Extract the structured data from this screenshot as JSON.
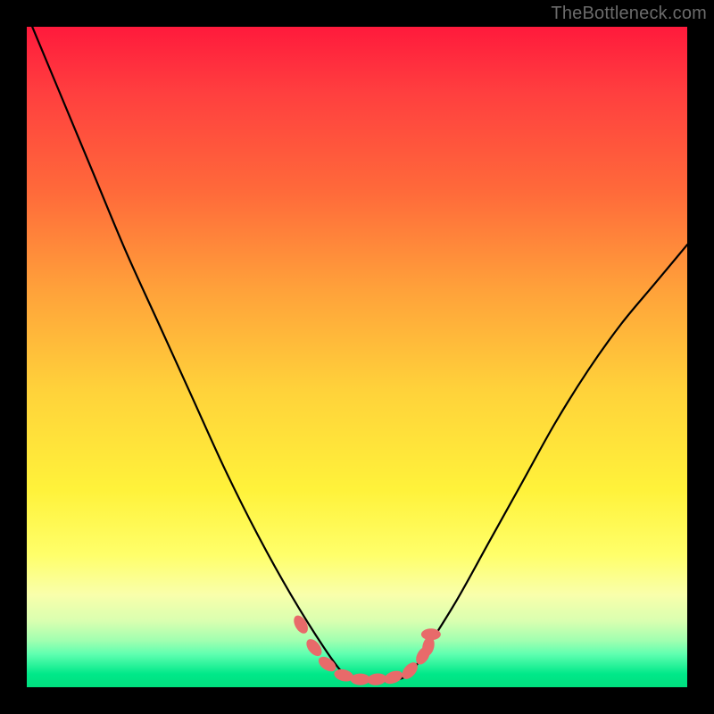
{
  "watermark": "TheBottleneck.com",
  "chart_data": {
    "type": "line",
    "title": "",
    "xlabel": "",
    "ylabel": "",
    "xlim": [
      0,
      1
    ],
    "ylim": [
      0,
      1
    ],
    "series": [
      {
        "name": "curve",
        "x": [
          0.0,
          0.05,
          0.1,
          0.15,
          0.2,
          0.25,
          0.3,
          0.35,
          0.4,
          0.45,
          0.48,
          0.5,
          0.55,
          0.58,
          0.6,
          0.65,
          0.7,
          0.75,
          0.8,
          0.85,
          0.9,
          0.95,
          1.0
        ],
        "y": [
          1.02,
          0.9,
          0.78,
          0.66,
          0.55,
          0.44,
          0.33,
          0.23,
          0.14,
          0.06,
          0.02,
          0.01,
          0.01,
          0.02,
          0.05,
          0.13,
          0.22,
          0.31,
          0.4,
          0.48,
          0.55,
          0.61,
          0.67
        ]
      },
      {
        "name": "markers",
        "x": [
          0.415,
          0.435,
          0.455,
          0.48,
          0.505,
          0.53,
          0.555,
          0.58,
          0.6,
          0.608,
          0.612
        ],
        "y": [
          0.095,
          0.06,
          0.035,
          0.018,
          0.012,
          0.012,
          0.015,
          0.025,
          0.048,
          0.062,
          0.08
        ]
      }
    ],
    "colors": {
      "curve": "#000000",
      "markers": "#e86a6a"
    }
  }
}
